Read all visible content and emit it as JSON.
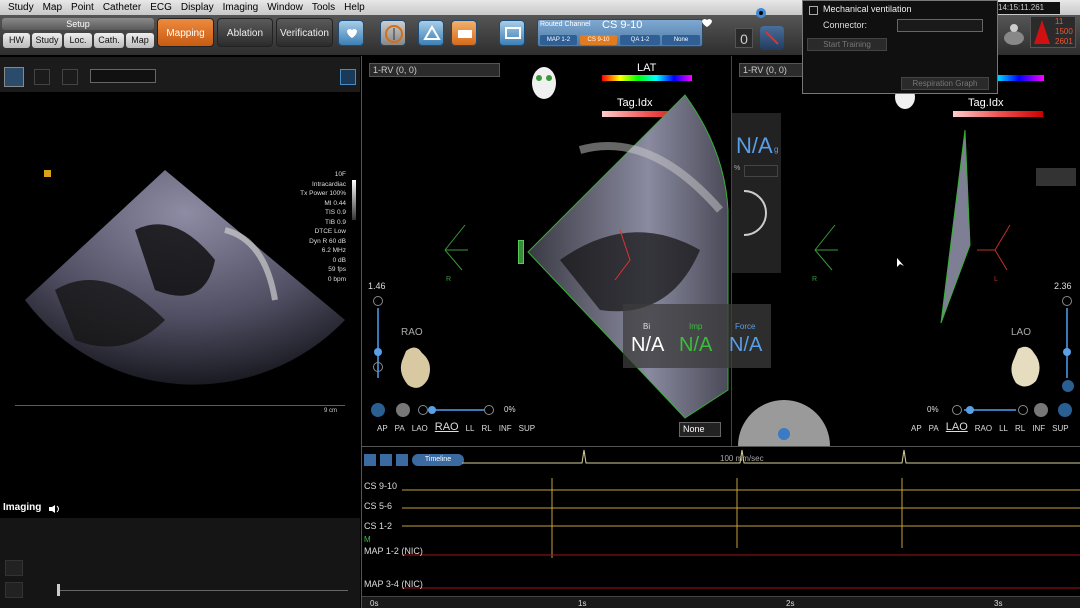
{
  "menu": [
    "Study",
    "Map",
    "Point",
    "Catheter",
    "ECG",
    "Display",
    "Imaging",
    "Window",
    "Tools",
    "Help"
  ],
  "setup": {
    "title": "Setup",
    "buttons": [
      "HW",
      "Study",
      "Loc.",
      "Cath.",
      "Map"
    ]
  },
  "modes": {
    "mapping": "Mapping",
    "ablation": "Ablation",
    "verification": "Verification"
  },
  "routed_channel": {
    "label": "Routed Channel",
    "value": "CS 9-10",
    "chips": [
      "MAP 1-2",
      "CS 9-10",
      "QA 1-2",
      "None"
    ]
  },
  "counter": "0",
  "time": "14:15:11.261",
  "alert": {
    "line1": "11",
    "line2": "1500",
    "line3": "2601"
  },
  "left_panel": {
    "readout": [
      "10F",
      "Intracardiac",
      "Tx Power 100%",
      "MI 0.44",
      "TIS 0.9",
      "TIB 0.9",
      "DTCE Low",
      "Dyn R 60 dB",
      "6.2 MHz",
      "0 dB",
      "59 fps",
      "0 bpm"
    ],
    "scale": "9 cm",
    "imaging_label": "Imaging"
  },
  "center_panel": {
    "selector": "1-RV (0, 0)",
    "lat": "LAT",
    "tag": "Tag.Idx",
    "zoom": "1.46",
    "view": "RAO",
    "pct": "0%",
    "views": [
      "AP",
      "PA",
      "LAO",
      "RAO",
      "LL",
      "RL",
      "INF",
      "SUP"
    ],
    "dropdown": "None",
    "metrics": {
      "bi_label": "Bi",
      "bi_val": "N/A",
      "imp_label": "Imp",
      "imp_val": "N/A",
      "force_label": "Force",
      "force_val": "N/A"
    },
    "na_big": "N/A",
    "na_sub": "g",
    "pct_mark": "%"
  },
  "right_panel": {
    "selector": "1-RV (0, 0)",
    "tag": "Tag.Idx",
    "zoom": "2.36",
    "view": "LAO",
    "pct": "0%",
    "views": [
      "AP",
      "PA",
      "LAO",
      "RAO",
      "LL",
      "RL",
      "INF",
      "SUP"
    ]
  },
  "orientation": {
    "r": "R",
    "l": "L"
  },
  "popup": {
    "title": "Mechanical ventilation",
    "connector": "Connector:",
    "start": "Start Training",
    "resp": "Respiration Graph"
  },
  "ecg": {
    "speed": "100 mm/sec",
    "timeline": "Timeline",
    "channels": [
      "CS 9-10",
      "CS 5-6",
      "CS 1-2",
      "MAP 1-2 (NIC)",
      "MAP 3-4 (NIC)"
    ],
    "marker": "M",
    "ticks": [
      "0s",
      "1s",
      "2s",
      "3s"
    ]
  },
  "colors": {
    "accent": "#e07b21",
    "ecg": "#c9a13a",
    "mesh": "#3ea63e",
    "alert": "#d11111"
  }
}
